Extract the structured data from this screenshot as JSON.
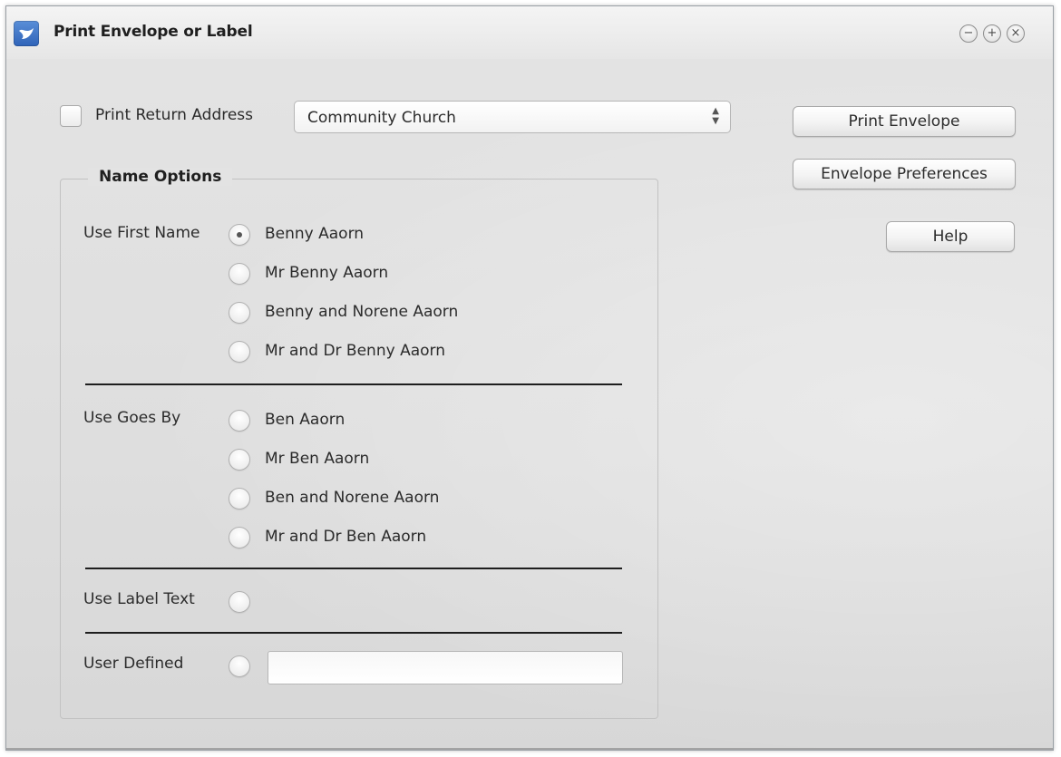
{
  "window": {
    "title": "Print Envelope or Label",
    "controls": {
      "minimize": "−",
      "maximize": "+",
      "close": "×"
    }
  },
  "return_address": {
    "checkbox_label": "Print Return Address",
    "checked": false,
    "selected": "Community Church"
  },
  "buttons": {
    "print_envelope": "Print Envelope",
    "envelope_preferences": "Envelope Preferences",
    "help": "Help"
  },
  "name_options": {
    "legend": "Name Options",
    "use_first_name": {
      "label": "Use First Name",
      "options": [
        "Benny Aaorn",
        "Mr Benny Aaorn",
        "Benny and Norene Aaorn",
        "Mr and Dr Benny Aaorn"
      ],
      "selected_index": 0
    },
    "use_goes_by": {
      "label": "Use Goes By",
      "options": [
        "Ben Aaorn",
        "Mr Ben Aaorn",
        "Ben and Norene Aaorn",
        "Mr and Dr Ben Aaorn"
      ]
    },
    "use_label_text": {
      "label": "Use Label Text"
    },
    "user_defined": {
      "label": "User Defined",
      "value": ""
    }
  },
  "icons": {
    "app": "church-envelope-icon",
    "minimize": "minimize-icon",
    "maximize": "maximize-icon",
    "close": "close-icon",
    "select_arrows": "up-down-arrows-icon"
  }
}
